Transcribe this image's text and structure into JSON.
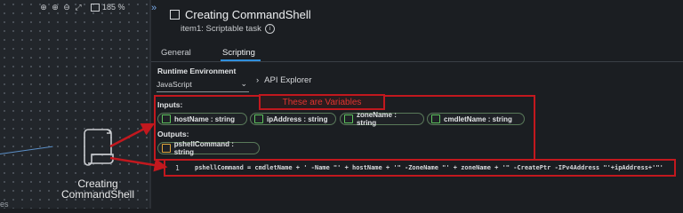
{
  "toolbar": {
    "icons": [
      "zoom-in-magnifier-icon",
      "zoom-in-icon",
      "zoom-out-icon",
      "fit-to-screen-icon",
      "minimap-icon"
    ],
    "zoom_level": "185 %"
  },
  "canvas": {
    "node_label": "Creating CommandShell",
    "node_icon": "scroll-icon",
    "bottom_text": "es"
  },
  "header": {
    "title": "Creating CommandShell",
    "subtitle": "item1: Scriptable task"
  },
  "tabs": [
    {
      "label": "General",
      "active": false
    },
    {
      "label": "Scripting",
      "active": true
    }
  ],
  "runtime": {
    "label": "Runtime Environment",
    "selected": "JavaScript"
  },
  "api_explorer": {
    "label": "API Explorer"
  },
  "inputs": {
    "label": "Inputs:",
    "items": [
      "hostName : string",
      "ipAddress : string",
      "zoneName : string",
      "cmdletName : string"
    ]
  },
  "outputs": {
    "label": "Outputs:",
    "items": [
      "pshellCommand : string"
    ]
  },
  "annotation": {
    "text": "These are Variables",
    "color": "#c2181e"
  },
  "code": {
    "line_number": "1",
    "line": "pshellCommand = cmdletName + ' -Name \"' + hostName + '\" -ZoneName \"' + zoneName + '\" -CreatePtr -IPv4Address \"'+ipAddress+'\"'"
  },
  "colors": {
    "background": "#1b1e22",
    "accent": "#2f8fdc",
    "annotation_red": "#c2181e",
    "input_icon": "#5ec45e",
    "output_icon": "#e0a53a"
  }
}
